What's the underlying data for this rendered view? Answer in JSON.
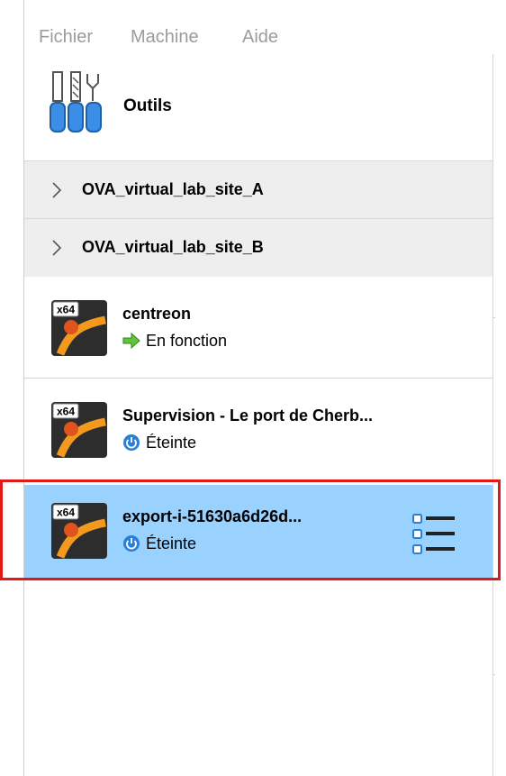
{
  "menu": {
    "items": [
      "Fichier",
      "Machine",
      "Aide"
    ]
  },
  "tools": {
    "label": "Outils",
    "icon": "tools-icon"
  },
  "groups": [
    {
      "label": "OVA_virtual_lab_site_A",
      "icon": "chevron-right-icon"
    },
    {
      "label": "OVA_virtual_lab_site_B",
      "icon": "chevron-right-icon"
    }
  ],
  "vms": [
    {
      "name": "centreon",
      "state": "En fonction",
      "state_icon": "running-arrow-icon",
      "os_badge": "x64"
    },
    {
      "name": "Supervision - Le port de Cherb...",
      "state": "Éteinte",
      "state_icon": "power-off-icon",
      "os_badge": "x64"
    },
    {
      "name": "export-i-51630a6d26d...",
      "state": "Éteinte",
      "state_icon": "power-off-icon",
      "os_badge": "x64",
      "selected": true
    }
  ],
  "colors": {
    "selection": "#99d1ff",
    "highlight_outline": "#e01a1a",
    "group_background": "#eeeeee",
    "menu_text": "#9c9c9c"
  }
}
